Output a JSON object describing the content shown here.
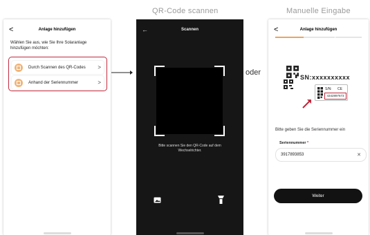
{
  "labels": {
    "scan": "QR-Code scannen",
    "manual": "Manuelle Eingabe",
    "or": "oder"
  },
  "screen1": {
    "back": "<",
    "title": "Anlage hinzufügen",
    "hint": "Wählen Sie aus, wie Sie Ihre Solaranlage hinzufügen möchten:",
    "options": [
      {
        "label": "Durch Scannen des QR-Codes",
        "chevron": ">"
      },
      {
        "label": "Anhand der Seriennummer",
        "chevron": ">"
      }
    ]
  },
  "screen2": {
    "back": "←",
    "title": "Scannen",
    "instruction": "Bitte scannen Sie den QR-Code auf dem Wechselrichter."
  },
  "screen3": {
    "back": "<",
    "title": "Anlage hinzufügen",
    "progress": 0.33,
    "sticker": {
      "big": "SN:xxxxxxxxxx",
      "small_label": "S/N:",
      "ce": "CE",
      "serial": "4342897673"
    },
    "prompt": "Bitte geben Sie die Seriennummer ein",
    "field_label": "Seriennummer",
    "required": "*",
    "field_value": "3917893853",
    "clear": "✕",
    "button": "Weiter"
  },
  "colors": {
    "accent": "#c0283c",
    "orange": "#f0a25a",
    "dark": "#121212"
  }
}
